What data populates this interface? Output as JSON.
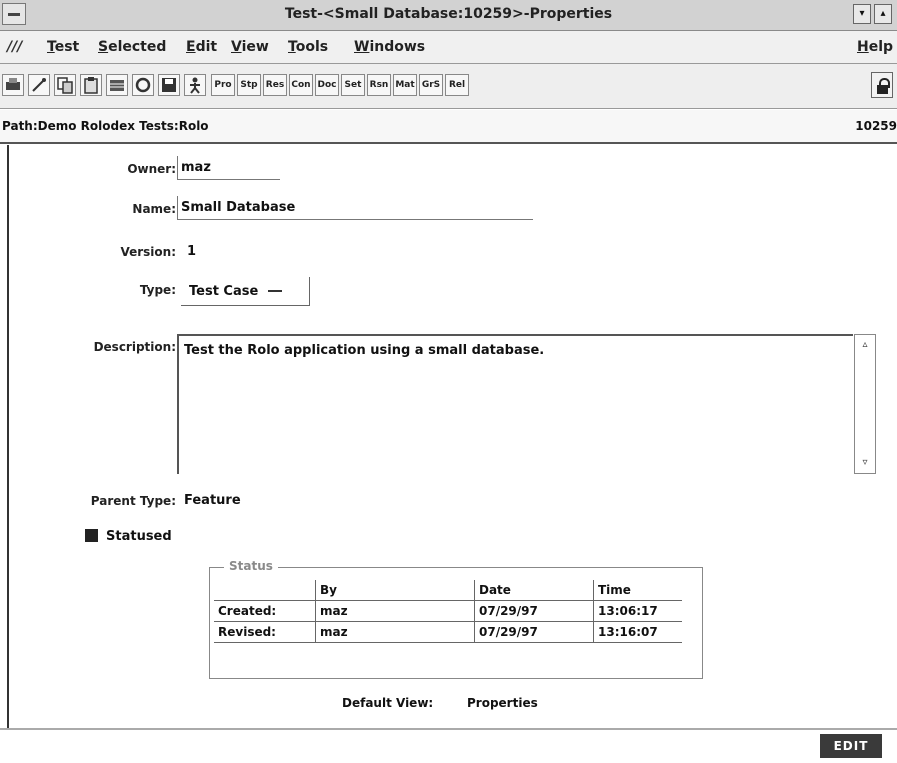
{
  "window": {
    "title": "Test-<Small Database:10259>-Properties",
    "minimize": "▾",
    "maximize": "▴"
  },
  "menubar": {
    "mark": "///",
    "items": [
      "Test",
      "Selected",
      "Edit",
      "View",
      "Tools",
      "Windows"
    ],
    "help": "Help"
  },
  "toolbar": {
    "icons": [
      "printer-icon",
      "wand-icon",
      "copy-icon",
      "paste-icon",
      "database-icon",
      "refresh-icon",
      "save-icon",
      "run-icon"
    ],
    "text_buttons": [
      "Pro",
      "Stp",
      "Res",
      "Con",
      "Doc",
      "Set",
      "Rsn",
      "Mat",
      "GrS",
      "Rel"
    ]
  },
  "path": {
    "text": "Path:Demo Rolodex Tests:Rolo",
    "id": "10259"
  },
  "form": {
    "owner_label": "Owner:",
    "owner_value": "maz",
    "name_label": "Name:",
    "name_value": "Small Database",
    "version_label": "Version:",
    "version_value": "1",
    "type_label": "Type:",
    "type_value": "Test Case",
    "description_label": "Description:",
    "description_value": "Test the Rolo application using a small database.",
    "parent_type_label": "Parent Type:",
    "parent_type_value": "Feature",
    "statused_label": "Statused",
    "statused_checked": true
  },
  "status": {
    "legend": "Status",
    "headers": [
      "",
      "By",
      "Date",
      "Time"
    ],
    "rows": [
      {
        "label": "Created:",
        "by": "maz",
        "date": "07/29/97",
        "time": "13:06:17"
      },
      {
        "label": "Revised:",
        "by": "maz",
        "date": "07/29/97",
        "time": "13:16:07"
      }
    ]
  },
  "default_view": {
    "label": "Default View:",
    "value": "Properties"
  },
  "edit_button": "EDIT"
}
